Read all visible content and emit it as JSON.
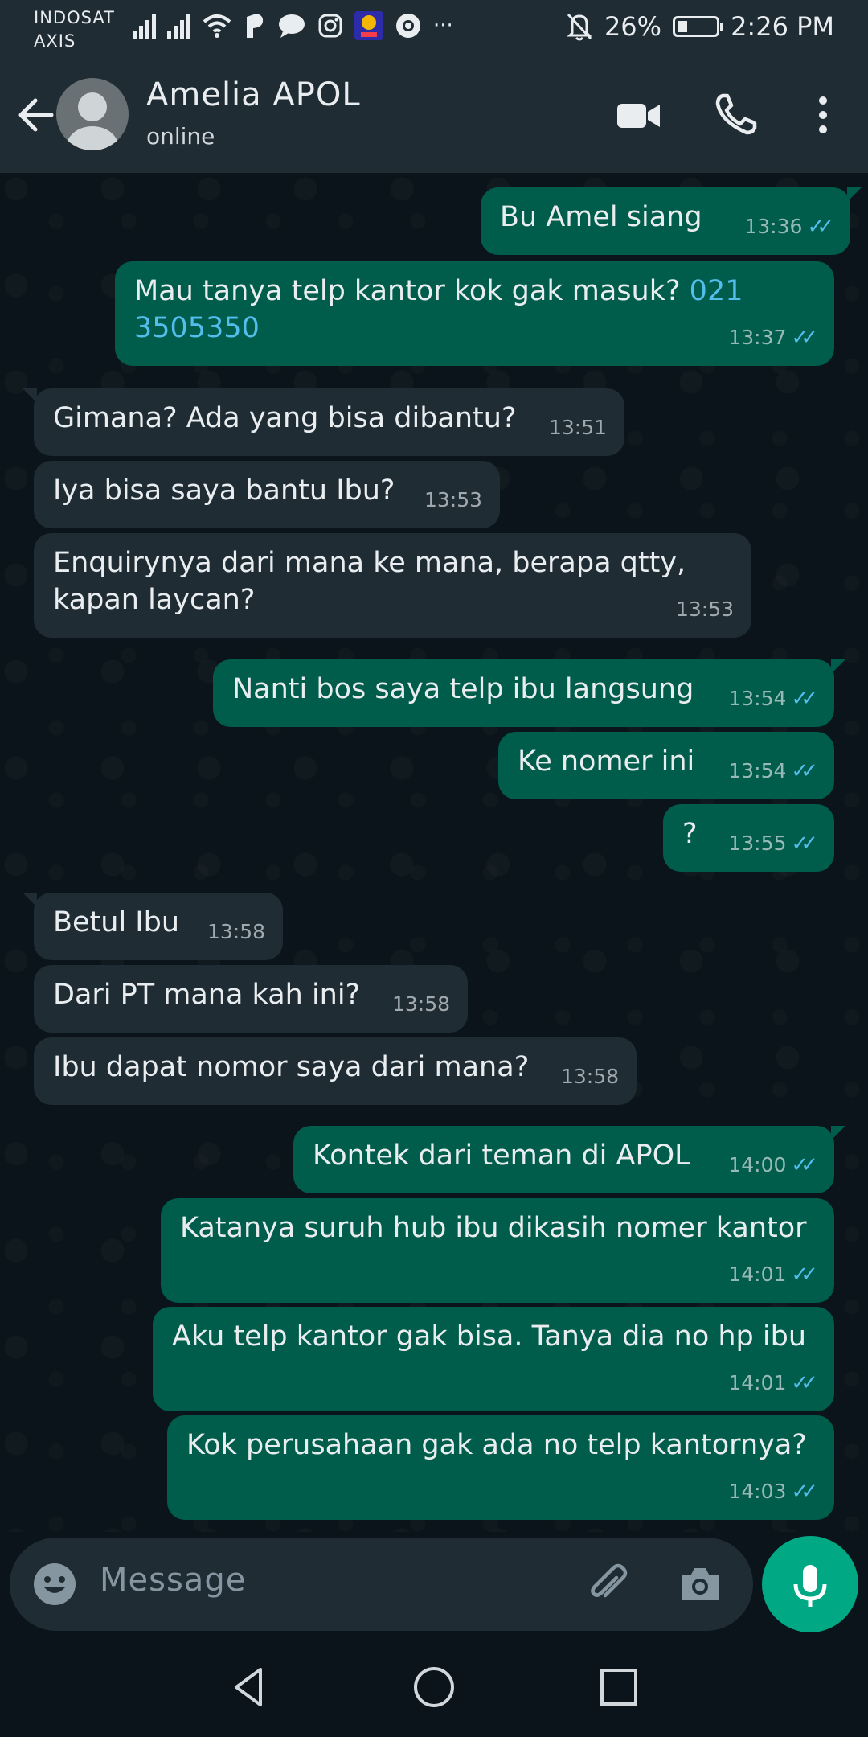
{
  "status_bar": {
    "carrier_line1": "INDOSAT",
    "carrier_line2": "AXIS",
    "battery": "26%",
    "battery_level": 0.26,
    "time": "2:26 PM",
    "more": "···"
  },
  "header": {
    "contact_name": "Amelia APOL",
    "contact_status": "online"
  },
  "messages": [
    {
      "dir": "out",
      "text": "Bu Amel siang",
      "time": "13:36"
    },
    {
      "dir": "out",
      "text": "Mau tanya telp kantor kok gak masuk? ",
      "link": "021 3505350",
      "time": "13:37"
    },
    {
      "dir": "in",
      "text": "Gimana? Ada yang bisa dibantu?",
      "time": "13:51"
    },
    {
      "dir": "in",
      "text": "Iya bisa saya bantu Ibu?",
      "time": "13:53"
    },
    {
      "dir": "in",
      "text": "Enquirynya dari mana ke mana, berapa qtty, kapan laycan?",
      "time": "13:53"
    },
    {
      "dir": "out",
      "text": "Nanti bos saya telp ibu langsung",
      "time": "13:54"
    },
    {
      "dir": "out",
      "text": "Ke nomer ini",
      "time": "13:54"
    },
    {
      "dir": "out",
      "text": "?",
      "time": "13:55"
    },
    {
      "dir": "in",
      "text": "Betul Ibu",
      "time": "13:58"
    },
    {
      "dir": "in",
      "text": "Dari PT mana kah ini?",
      "time": "13:58"
    },
    {
      "dir": "in",
      "text": "Ibu dapat nomor saya dari mana?",
      "time": "13:58"
    },
    {
      "dir": "out",
      "text": "Kontek dari teman di APOL",
      "time": "14:00"
    },
    {
      "dir": "out",
      "text": "Katanya suruh hub ibu dikasih nomer kantor",
      "time": "14:01"
    },
    {
      "dir": "out",
      "text": "Aku telp kantor gak bisa. Tanya dia no hp ibu",
      "time": "14:01"
    },
    {
      "dir": "out",
      "text": "Kok perusahaan gak ada no telp kantornya?",
      "time": "14:03"
    }
  ],
  "input": {
    "placeholder": "Message"
  },
  "colors": {
    "outgoing_bubble": "#005c4b",
    "incoming_bubble": "#1f2c34",
    "read_ticks": "#53bdeb",
    "accent": "#00a884"
  }
}
